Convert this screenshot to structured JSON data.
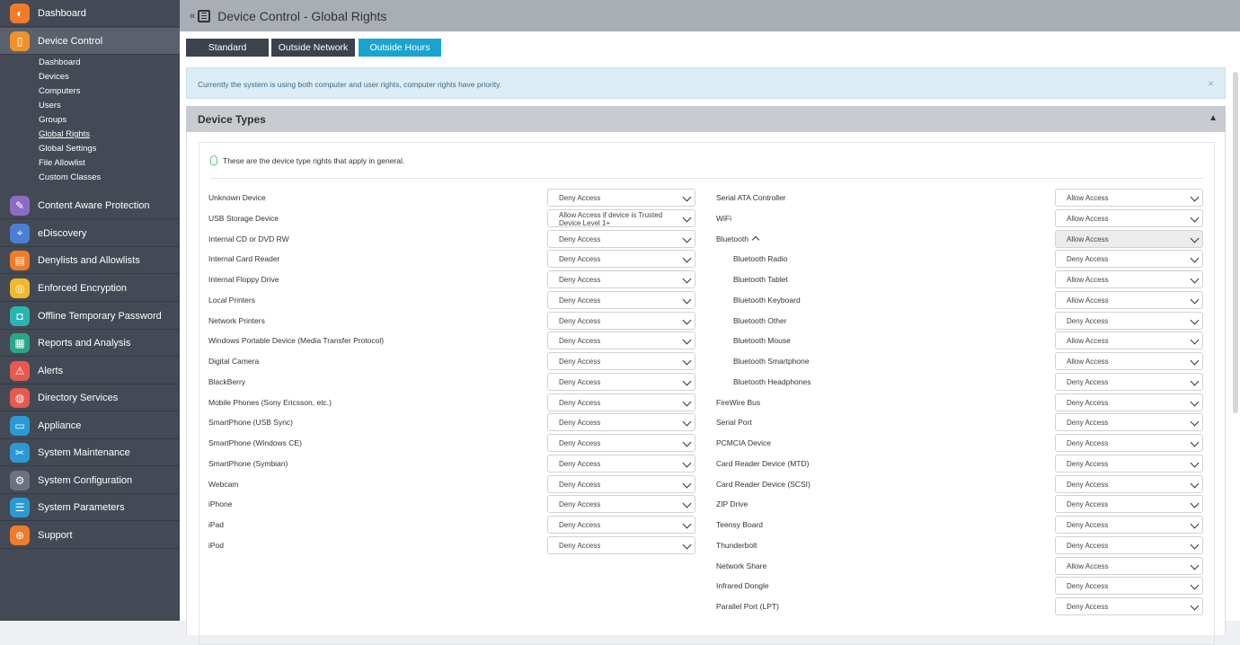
{
  "header": {
    "title": "Device Control - Global Rights",
    "collapse_glyph": "«"
  },
  "sidebar": {
    "items": [
      {
        "label": "Dashboard",
        "icon": "dashboard-icon",
        "color": "#f07b2b",
        "glyph": "◐"
      },
      {
        "label": "Device Control",
        "icon": "device-control-icon",
        "color": "#f0922b",
        "glyph": "▯"
      },
      {
        "label": "Content Aware Protection",
        "icon": "content-aware-icon",
        "color": "#8b6cc5",
        "glyph": "✎"
      },
      {
        "label": "eDiscovery",
        "icon": "ediscovery-icon",
        "color": "#4a7fd4",
        "glyph": "⌖"
      },
      {
        "label": "Denylists and Allowlists",
        "icon": "denylists-icon",
        "color": "#f07b2b",
        "glyph": "▤"
      },
      {
        "label": "Enforced Encryption",
        "icon": "encryption-icon",
        "color": "#f0b82b",
        "glyph": "◎"
      },
      {
        "label": "Offline Temporary Password",
        "icon": "password-icon",
        "color": "#2bb5b0",
        "glyph": "◘"
      },
      {
        "label": "Reports and Analysis",
        "icon": "reports-icon",
        "color": "#2ba58a",
        "glyph": "▦"
      },
      {
        "label": "Alerts",
        "icon": "alerts-icon",
        "color": "#e8594f",
        "glyph": "⚠"
      },
      {
        "label": "Directory Services",
        "icon": "directory-icon",
        "color": "#e8594f",
        "glyph": "◍"
      },
      {
        "label": "Appliance",
        "icon": "appliance-icon",
        "color": "#2b9ad4",
        "glyph": "▭"
      },
      {
        "label": "System Maintenance",
        "icon": "maintenance-icon",
        "color": "#2b9ad4",
        "glyph": "✂"
      },
      {
        "label": "System Configuration",
        "icon": "configuration-icon",
        "color": "#6b7380",
        "glyph": "⚙"
      },
      {
        "label": "System Parameters",
        "icon": "parameters-icon",
        "color": "#2b9ad4",
        "glyph": "☰"
      },
      {
        "label": "Support",
        "icon": "support-icon",
        "color": "#f07b2b",
        "glyph": "⊕"
      }
    ],
    "sub_items": [
      "Dashboard",
      "Devices",
      "Computers",
      "Users",
      "Groups",
      "Global Rights",
      "Global Settings",
      "File Allowlist",
      "Custom Classes"
    ]
  },
  "tabs": [
    {
      "label": "Standard",
      "color": "#3d434d"
    },
    {
      "label": "Outside Network",
      "color": "#3d434d"
    },
    {
      "label": "Outside Hours",
      "color": "#1aa4cf"
    }
  ],
  "alert": {
    "text": "Currently the system is using both computer and user rights, computer rights have priority.",
    "close": "×"
  },
  "panel": {
    "title": "Device Types",
    "hint": "These are the device type rights that apply in general."
  },
  "left_rows": [
    {
      "label": "Unknown Device",
      "value": "Deny Access"
    },
    {
      "label": "USB Storage Device",
      "value": "Allow Access if device is Trusted Device Level 1+"
    },
    {
      "label": "Internal CD or DVD RW",
      "value": "Deny Access"
    },
    {
      "label": "Internal Card Reader",
      "value": "Deny Access"
    },
    {
      "label": "Internal Floppy Drive",
      "value": "Deny Access"
    },
    {
      "label": "Local Printers",
      "value": "Deny Access"
    },
    {
      "label": "Network Printers",
      "value": "Deny Access"
    },
    {
      "label": "Windows Portable Device (Media Transfer Protocol)",
      "value": "Deny Access"
    },
    {
      "label": "Digital Camera",
      "value": "Deny Access"
    },
    {
      "label": "BlackBerry",
      "value": "Deny Access"
    },
    {
      "label": "Mobile Phones (Sony Ericsson, etc.)",
      "value": "Deny Access"
    },
    {
      "label": "SmartPhone (USB Sync)",
      "value": "Deny Access"
    },
    {
      "label": "SmartPhone (Windows CE)",
      "value": "Deny Access"
    },
    {
      "label": "SmartPhone (Symbian)",
      "value": "Deny Access"
    },
    {
      "label": "Webcam",
      "value": "Deny Access"
    },
    {
      "label": "iPhone",
      "value": "Deny Access"
    },
    {
      "label": "iPad",
      "value": "Deny Access"
    },
    {
      "label": "iPod",
      "value": "Deny Access"
    }
  ],
  "right_rows": [
    {
      "label": "Serial ATA Controller",
      "value": "Allow Access"
    },
    {
      "label": "WiFi",
      "value": "Allow Access"
    },
    {
      "label": "Bluetooth",
      "value": "Allow Access",
      "expanded": true
    },
    {
      "label": "Bluetooth Radio",
      "value": "Deny Access",
      "sub": true
    },
    {
      "label": "Bluetooth Tablet",
      "value": "Allow Access",
      "sub": true
    },
    {
      "label": "Bluetooth Keyboard",
      "value": "Allow Access",
      "sub": true
    },
    {
      "label": "Bluetooth Other",
      "value": "Deny Access",
      "sub": true
    },
    {
      "label": "Bluetooth Mouse",
      "value": "Allow Access",
      "sub": true
    },
    {
      "label": "Bluetooth Smartphone",
      "value": "Allow Access",
      "sub": true
    },
    {
      "label": "Bluetooth Headphones",
      "value": "Deny Access",
      "sub": true
    },
    {
      "label": "FireWire Bus",
      "value": "Deny Access"
    },
    {
      "label": "Serial Port",
      "value": "Deny Access"
    },
    {
      "label": "PCMCIA Device",
      "value": "Deny Access"
    },
    {
      "label": "Card Reader Device (MTD)",
      "value": "Deny Access"
    },
    {
      "label": "Card Reader Device (SCSI)",
      "value": "Deny Access"
    },
    {
      "label": "ZIP Drive",
      "value": "Deny Access"
    },
    {
      "label": "Teensy Board",
      "value": "Deny Access"
    },
    {
      "label": "Thunderbolt",
      "value": "Deny Access"
    },
    {
      "label": "Network Share",
      "value": "Allow Access"
    },
    {
      "label": "Infrared Dongle",
      "value": "Deny Access"
    },
    {
      "label": "Parallel Port (LPT)",
      "value": "Deny Access"
    }
  ]
}
